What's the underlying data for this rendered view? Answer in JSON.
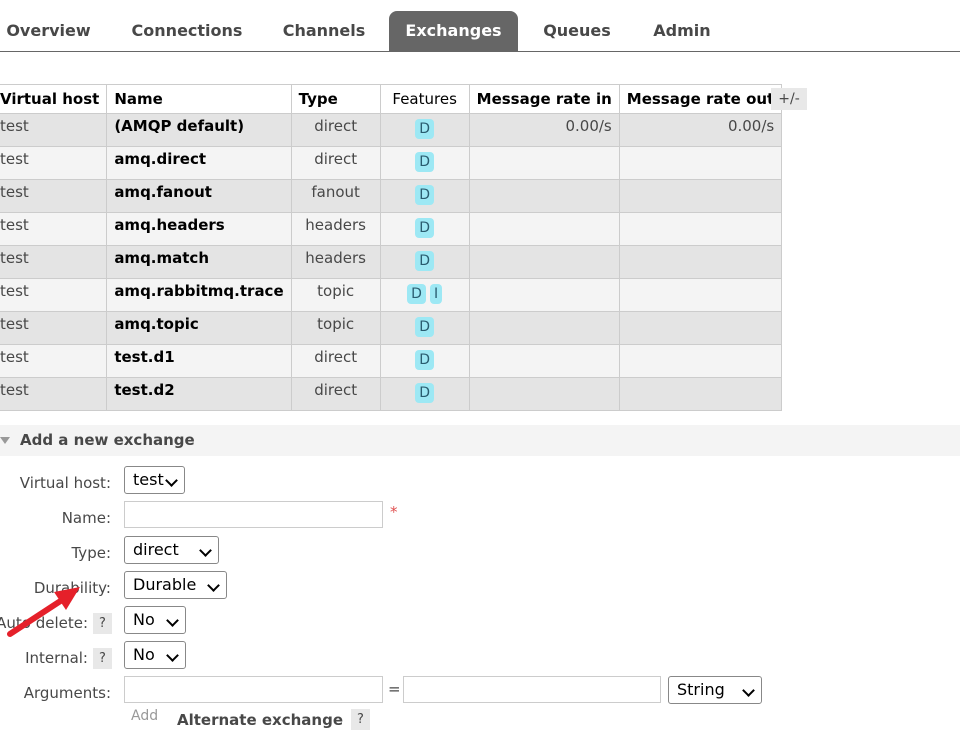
{
  "nav": {
    "tabs": [
      {
        "label": "Overview"
      },
      {
        "label": "Connections"
      },
      {
        "label": "Channels"
      },
      {
        "label": "Exchanges",
        "active": true
      },
      {
        "label": "Queues"
      },
      {
        "label": "Admin"
      }
    ]
  },
  "table": {
    "headers": [
      "Virtual host",
      "Name",
      "Type",
      "Features",
      "Message rate in",
      "Message rate out"
    ],
    "toggle_label": "+/-",
    "rows": [
      {
        "vhost": "test",
        "name": "(AMQP default)",
        "type": "direct",
        "features": [
          "D"
        ],
        "rate_in": "0.00/s",
        "rate_out": "0.00/s"
      },
      {
        "vhost": "test",
        "name": "amq.direct",
        "type": "direct",
        "features": [
          "D"
        ],
        "rate_in": "",
        "rate_out": ""
      },
      {
        "vhost": "test",
        "name": "amq.fanout",
        "type": "fanout",
        "features": [
          "D"
        ],
        "rate_in": "",
        "rate_out": ""
      },
      {
        "vhost": "test",
        "name": "amq.headers",
        "type": "headers",
        "features": [
          "D"
        ],
        "rate_in": "",
        "rate_out": ""
      },
      {
        "vhost": "test",
        "name": "amq.match",
        "type": "headers",
        "features": [
          "D"
        ],
        "rate_in": "",
        "rate_out": ""
      },
      {
        "vhost": "test",
        "name": "amq.rabbitmq.trace",
        "type": "topic",
        "features": [
          "D",
          "I"
        ],
        "rate_in": "",
        "rate_out": ""
      },
      {
        "vhost": "test",
        "name": "amq.topic",
        "type": "topic",
        "features": [
          "D"
        ],
        "rate_in": "",
        "rate_out": ""
      },
      {
        "vhost": "test",
        "name": "test.d1",
        "type": "direct",
        "features": [
          "D"
        ],
        "rate_in": "",
        "rate_out": ""
      },
      {
        "vhost": "test",
        "name": "test.d2",
        "type": "direct",
        "features": [
          "D"
        ],
        "rate_in": "",
        "rate_out": ""
      }
    ]
  },
  "form": {
    "section_title": "Add a new exchange",
    "virtual_host_label": "Virtual host:",
    "virtual_host_value": "test",
    "name_label": "Name:",
    "required_mark": "*",
    "type_label": "Type:",
    "type_value": "direct",
    "durability_label": "Durability:",
    "durability_value": "Durable",
    "auto_delete_label": "Auto delete:",
    "auto_delete_value": "No",
    "internal_label": "Internal:",
    "internal_value": "No",
    "arguments_label": "Arguments:",
    "equals": "=",
    "arg_type_value": "String",
    "add_label": "Add",
    "alternate_exchange_label": "Alternate exchange",
    "help_label": "?"
  },
  "colors": {
    "accent_tab": "#666666",
    "badge": "#9de8f4",
    "arrow": "#e5202a"
  }
}
